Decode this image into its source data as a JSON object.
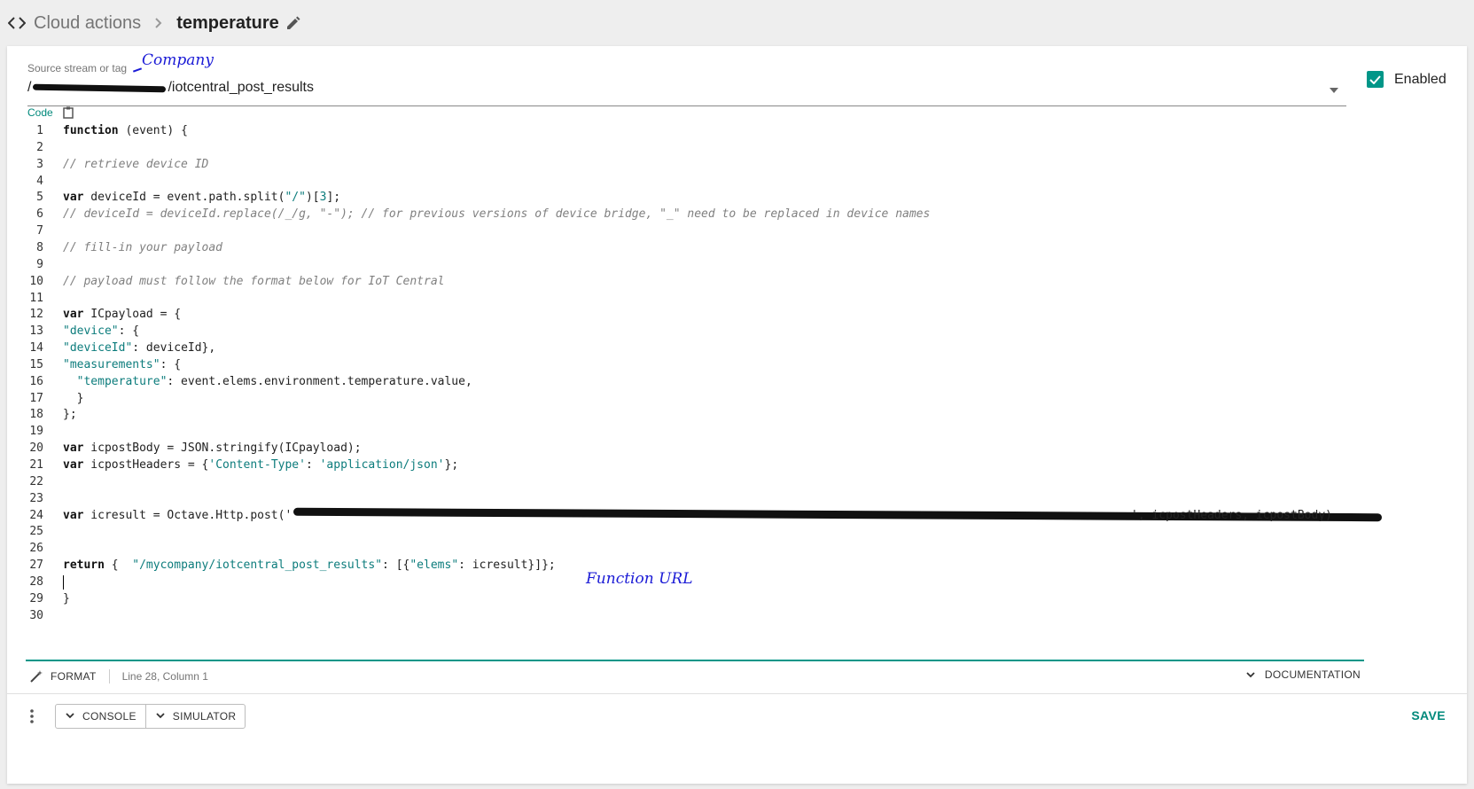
{
  "breadcrumb": {
    "parent": "Cloud actions",
    "current": "temperature"
  },
  "source": {
    "label": "Source stream or tag",
    "value_prefix": "/",
    "value_suffix": "/iotcentral_post_results"
  },
  "annotations": {
    "company": "Company",
    "function_url": "Function URL"
  },
  "enabled": {
    "label": "Enabled",
    "checked": true
  },
  "code_label": "Code",
  "code_lines": [
    "function (event) {",
    "",
    "// retrieve device ID",
    "",
    "var deviceId = event.path.split(\"/\")[3];",
    "// deviceId = deviceId.replace(/_/g, \"-\"); // for previous versions of device bridge, \"_\" need to be replaced in device names",
    "",
    "// fill-in your payload",
    "",
    "// payload must follow the format below for IoT Central",
    "",
    "var ICpayload = {",
    "\"device\": {",
    "\"deviceId\": deviceId},",
    "\"measurements\": {",
    "  \"temperature\": event.elems.environment.temperature.value,",
    "  }",
    "};",
    "",
    "var icpostBody = JSON.stringify(ICpayload);",
    "var icpostHeaders = {'Content-Type': 'application/json'};",
    "",
    "",
    "var icresult = Octave.Http.post('",
    "",
    "",
    "return {  \"/mycompany/iotcentral_post_results\": [{\"elems\": icresult}]};",
    "",
    "}",
    ""
  ],
  "line24_tail": "', icpostHeaders, icpostBody)",
  "status": {
    "format_label": "FORMAT",
    "cursor_position": "Line 28, Column 1",
    "documentation_label": "DOCUMENTATION"
  },
  "bottom": {
    "console_label": "CONSOLE",
    "simulator_label": "SIMULATOR",
    "save_label": "SAVE"
  },
  "colors": {
    "accent": "#009688",
    "annotation_ink": "#1a1ad6"
  }
}
